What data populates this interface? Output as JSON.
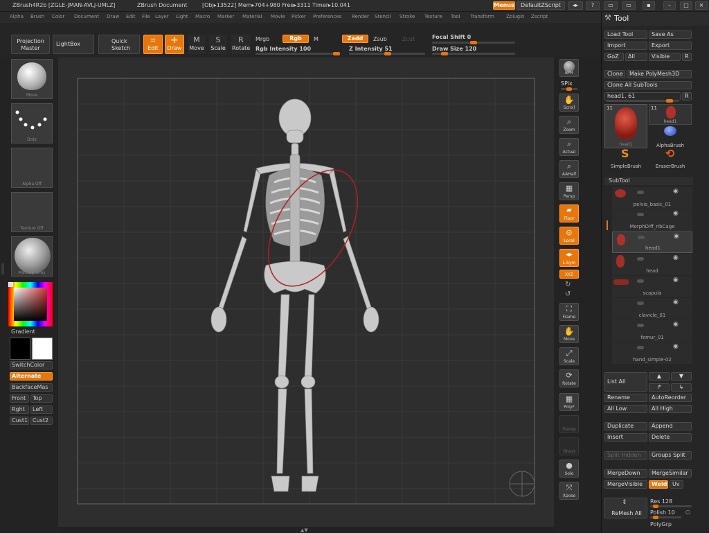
{
  "titlebar": {
    "app": "ZBrush4R2b [ZGLE-JMAN-AVLJ-UMLZ]",
    "doc": "ZBrush Document",
    "stats": "[Obj▸13522] Mem▸704+980 Free▸3311 Timer▸10.041",
    "menus_btn": "Menus",
    "script_btn": "DefaultZScript"
  },
  "menubar": [
    "Alpha",
    "Brush",
    "Color",
    "Document",
    "Draw",
    "Edit",
    "File",
    "Layer",
    "Light",
    "Macro",
    "Marker",
    "Material",
    "Movie",
    "Picker",
    "Preferences",
    "Render",
    "Stencil",
    "Stroke",
    "Texture",
    "Tool",
    "Transform",
    "Zplugin",
    "Zscript"
  ],
  "toolrow": {
    "projection_master": [
      "Projection",
      "Master"
    ],
    "lightbox": "LightBox",
    "quick_sketch": [
      "Quick",
      "Sketch"
    ],
    "edit": "Edit",
    "draw": "Draw",
    "move": "Move",
    "scale": "Scale",
    "rotate": "Rotate",
    "mrgb": "Mrgb",
    "rgb": "Rgb",
    "m": "M",
    "rgb_intensity": "Rgb Intensity 100",
    "zadd": "Zadd",
    "zsub": "Zsub",
    "zcut": "Zcut",
    "z_intensity": "Z Intensity 51",
    "focal_shift": "Focal Shift 0",
    "draw_size": "Draw Size 120",
    "rgb_intensity_level": 1.0,
    "z_intensity_level": 0.51,
    "focal_shift_level": 0.5,
    "draw_size_level": 0.12
  },
  "leftshelf": {
    "brush_caption": "Move",
    "stroke_caption": "Dots",
    "alpha_caption": "Alpha Off",
    "texture_caption": "Texture Off",
    "material_caption": "MatCap Gray",
    "gradient": "Gradient",
    "switchcolor": "SwitchColor",
    "alternate": "Alternate",
    "backface": "BackfaceMas",
    "front": "Front",
    "top": "Top",
    "right": "Rght",
    "left": "Left",
    "cust1": "Cust1",
    "cust2": "Cust2"
  },
  "rightshelf": [
    "BPR",
    "SPix",
    "Scroll",
    "Zoom",
    "Actual",
    "AAHalf",
    "Persp",
    "Floor",
    "Local",
    "L.Sym",
    "XYZ",
    "Frame",
    "Move",
    "Scale",
    "Rotate",
    "PolyF",
    "Transp",
    "Ghost",
    "Solo",
    "Xpose"
  ],
  "panel": {
    "title": "Tool",
    "load_tool": "Load Tool",
    "save_as": "Save As",
    "import": "Import",
    "export": "Export",
    "goz": "GoZ",
    "all": "All",
    "visible": "Visible",
    "r": "R",
    "clone": "Clone",
    "make_polymesh": "Make PolyMesh3D",
    "clone_all": "Clone All SubTools",
    "current_tool": "head1. 61",
    "tools": [
      "head1",
      "head1",
      "AlphaBrush",
      "SimpleBrush",
      "EraserBrush"
    ],
    "tool_counts": [
      "11",
      "11"
    ],
    "subtool_header": "SubTool",
    "subtools": [
      "pelvis_basic_01",
      "MorphDiff_ribCage",
      "head1",
      "head",
      "scapula",
      "clavicle_01",
      "femur_01",
      "hand_simple-02"
    ],
    "list_all": "List All",
    "rename": "Rename",
    "autoreorder": "AutoReorder",
    "all_low": "All Low",
    "all_high": "All High",
    "duplicate": "Duplicate",
    "append": "Append",
    "insert": "Insert",
    "delete": "Delete",
    "split_hidden": "Split Hidden",
    "groups_split": "Groups Split",
    "mergedown": "MergeDown",
    "mergesimilar": "MergeSimilar",
    "mergevisible": "MergeVisible",
    "weld": "Weld",
    "uv": "Uv",
    "remesh_all": "ReMesh All",
    "res": "Res 128",
    "polish": "Polish 10",
    "polygrp": "PolyGrp"
  }
}
